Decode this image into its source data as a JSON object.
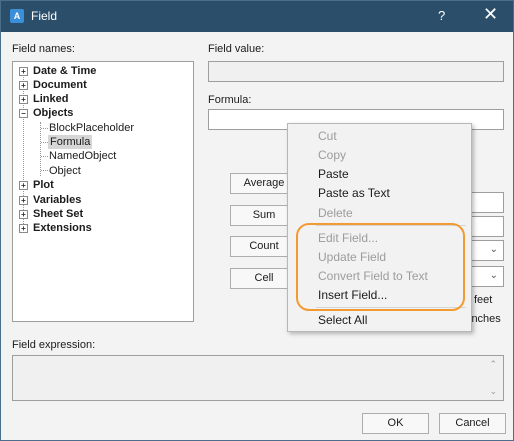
{
  "window": {
    "title": "Field",
    "help_glyph": "?",
    "close_glyph": "✕",
    "app_icon_glyph": "A"
  },
  "labels": {
    "field_names": "Field names:",
    "field_value": "Field value:",
    "formula": "Formula:",
    "field_expression": "Field expression:"
  },
  "tree": {
    "items": [
      {
        "label": "Date & Time",
        "bold": true,
        "expander": "+"
      },
      {
        "label": "Document",
        "bold": true,
        "expander": "+"
      },
      {
        "label": "Linked",
        "bold": true,
        "expander": "+"
      },
      {
        "label": "Objects",
        "bold": true,
        "expander": "−"
      },
      {
        "label": "BlockPlaceholder",
        "bold": false
      },
      {
        "label": "Formula",
        "bold": false,
        "selected": true
      },
      {
        "label": "NamedObject",
        "bold": false
      },
      {
        "label": "Object",
        "bold": false
      },
      {
        "label": "Plot",
        "bold": true,
        "expander": "+"
      },
      {
        "label": "Variables",
        "bold": true,
        "expander": "+"
      },
      {
        "label": "Sheet Set",
        "bold": true,
        "expander": "+"
      },
      {
        "label": "Extensions",
        "bold": true,
        "expander": "+"
      }
    ]
  },
  "buttons": {
    "average": "Average",
    "sum": "Sum",
    "count": "Count",
    "cell": "Cell",
    "ok": "OK",
    "cancel": "Cancel"
  },
  "partial_text": {
    "feet": "feet",
    "inches": "inches"
  },
  "context_menu": {
    "items": [
      {
        "label": "Cut",
        "enabled": false
      },
      {
        "label": "Copy",
        "enabled": false
      },
      {
        "label": "Paste",
        "enabled": true
      },
      {
        "label": "Paste as Text",
        "enabled": true
      },
      {
        "label": "Delete",
        "enabled": false
      },
      {
        "label": "Edit Field...",
        "enabled": false
      },
      {
        "label": "Update Field",
        "enabled": false
      },
      {
        "label": "Convert Field to Text",
        "enabled": false
      },
      {
        "label": "Insert Field...",
        "enabled": true
      },
      {
        "label": "Select All",
        "enabled": true
      }
    ],
    "highlight_color": "#f29b32"
  },
  "colors": {
    "titlebar": "#2b4f6b",
    "accent": "#3b8fd8"
  }
}
